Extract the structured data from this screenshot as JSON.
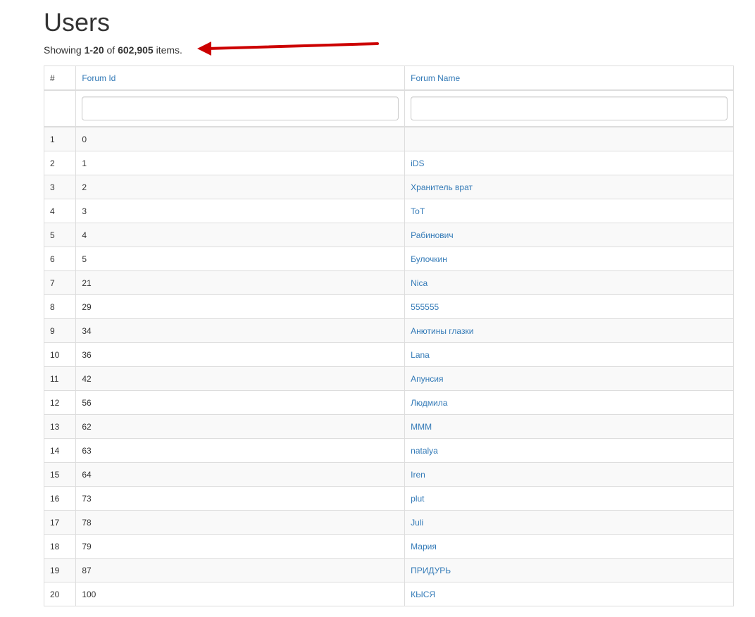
{
  "page": {
    "title": "Users"
  },
  "summary": {
    "prefix": "Showing ",
    "range": "1-20",
    "middle": " of ",
    "total": "602,905",
    "suffix": " items."
  },
  "annotation": {
    "arrow_color": "#cc0000"
  },
  "colors": {
    "link": "#337ab7",
    "text": "#333333",
    "border": "#dddddd",
    "stripe": "#f9f9f9"
  },
  "table": {
    "columns": {
      "num": "#",
      "forum_id": "Forum Id",
      "forum_name": "Forum Name"
    },
    "filters": {
      "forum_id": "",
      "forum_name": ""
    },
    "rows": [
      {
        "num": "1",
        "forum_id": "0",
        "forum_name": ""
      },
      {
        "num": "2",
        "forum_id": "1",
        "forum_name": "iDS"
      },
      {
        "num": "3",
        "forum_id": "2",
        "forum_name": "Хранитель врат"
      },
      {
        "num": "4",
        "forum_id": "3",
        "forum_name": "ToT"
      },
      {
        "num": "5",
        "forum_id": "4",
        "forum_name": "Рабинович"
      },
      {
        "num": "6",
        "forum_id": "5",
        "forum_name": "Булочкин"
      },
      {
        "num": "7",
        "forum_id": "21",
        "forum_name": "Nica"
      },
      {
        "num": "8",
        "forum_id": "29",
        "forum_name": "555555"
      },
      {
        "num": "9",
        "forum_id": "34",
        "forum_name": "Анютины глазки"
      },
      {
        "num": "10",
        "forum_id": "36",
        "forum_name": "Lana"
      },
      {
        "num": "11",
        "forum_id": "42",
        "forum_name": "Апунсия"
      },
      {
        "num": "12",
        "forum_id": "56",
        "forum_name": "Людмила"
      },
      {
        "num": "13",
        "forum_id": "62",
        "forum_name": "МММ"
      },
      {
        "num": "14",
        "forum_id": "63",
        "forum_name": "natalya"
      },
      {
        "num": "15",
        "forum_id": "64",
        "forum_name": "Iren"
      },
      {
        "num": "16",
        "forum_id": "73",
        "forum_name": "plut"
      },
      {
        "num": "17",
        "forum_id": "78",
        "forum_name": "Juli"
      },
      {
        "num": "18",
        "forum_id": "79",
        "forum_name": "Мария"
      },
      {
        "num": "19",
        "forum_id": "87",
        "forum_name": "ПРИДУРЬ"
      },
      {
        "num": "20",
        "forum_id": "100",
        "forum_name": "КЫСЯ"
      }
    ]
  }
}
